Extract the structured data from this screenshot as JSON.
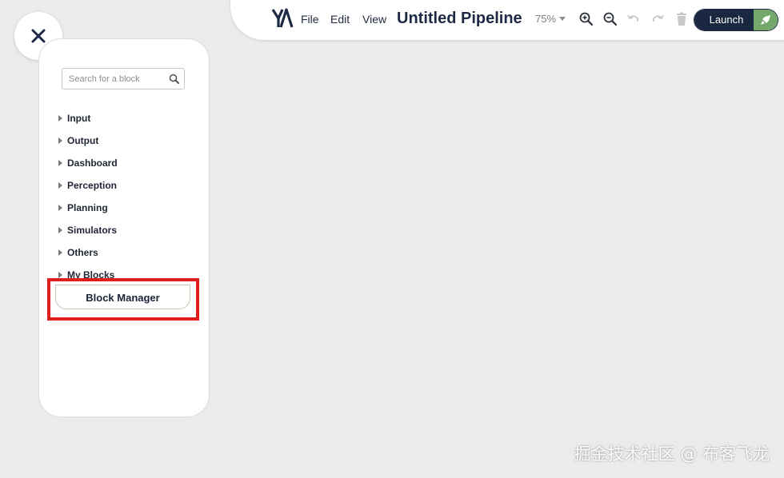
{
  "toolbar": {
    "logo_icon": "ya-logo-icon",
    "menu": {
      "file": "File",
      "edit": "Edit",
      "view": "View"
    },
    "title": "Untitled Pipeline",
    "zoom_level": "75%",
    "launch_label": "Launch",
    "colors": {
      "navy": "#1a2740",
      "green": "#74a86a"
    }
  },
  "sidebar": {
    "search_placeholder": "Search for a block",
    "categories": [
      {
        "label": "Input"
      },
      {
        "label": "Output"
      },
      {
        "label": "Dashboard"
      },
      {
        "label": "Perception"
      },
      {
        "label": "Planning"
      },
      {
        "label": "Simulators"
      },
      {
        "label": "Others"
      },
      {
        "label": "My Blocks"
      }
    ],
    "block_manager_label": "Block Manager"
  },
  "watermark": "掘金技术社区 @ 布客飞龙"
}
